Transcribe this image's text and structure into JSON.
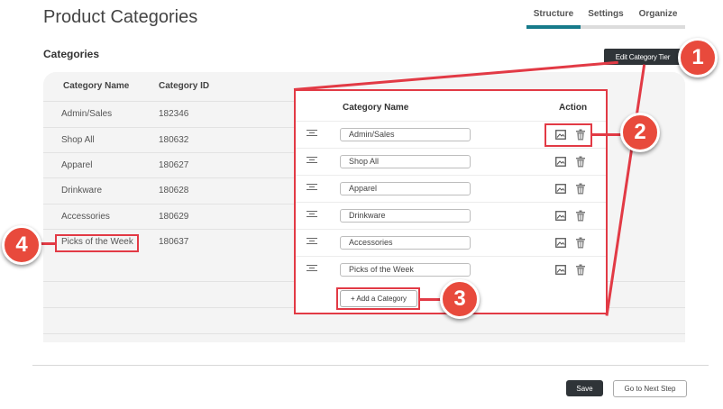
{
  "header": {
    "title": "Product Categories",
    "tabs": [
      {
        "label": "Structure",
        "active": true
      },
      {
        "label": "Settings",
        "active": false
      },
      {
        "label": "Organize",
        "active": false
      }
    ]
  },
  "section": {
    "title": "Categories",
    "edit_tier_label": "Edit Category Tier"
  },
  "category_table": {
    "columns": [
      "Category Name",
      "Category ID"
    ],
    "rows": [
      {
        "name": "Admin/Sales",
        "id": "182346"
      },
      {
        "name": "Shop All",
        "id": "180632"
      },
      {
        "name": "Apparel",
        "id": "180627"
      },
      {
        "name": "Drinkware",
        "id": "180628"
      },
      {
        "name": "Accessories",
        "id": "180629"
      },
      {
        "name": "Picks of the Week",
        "id": "180637"
      }
    ]
  },
  "edit_panel": {
    "col_name": "Category Name",
    "col_action": "Action",
    "items": [
      "Admin/Sales",
      "Shop All",
      "Apparel",
      "Drinkware",
      "Accessories",
      "Picks of the Week"
    ],
    "add_label": "+ Add a Category"
  },
  "callouts": [
    "1",
    "2",
    "3",
    "4"
  ],
  "footer": {
    "save_label": "Save",
    "next_label": "Go to Next Step"
  },
  "colors": {
    "accent": "#167a8a",
    "highlight": "#e23a45",
    "badge": "#e84a3c",
    "dark_button": "#2f3438"
  },
  "icons": [
    "drag-handle-icon",
    "image-icon",
    "trash-icon"
  ]
}
